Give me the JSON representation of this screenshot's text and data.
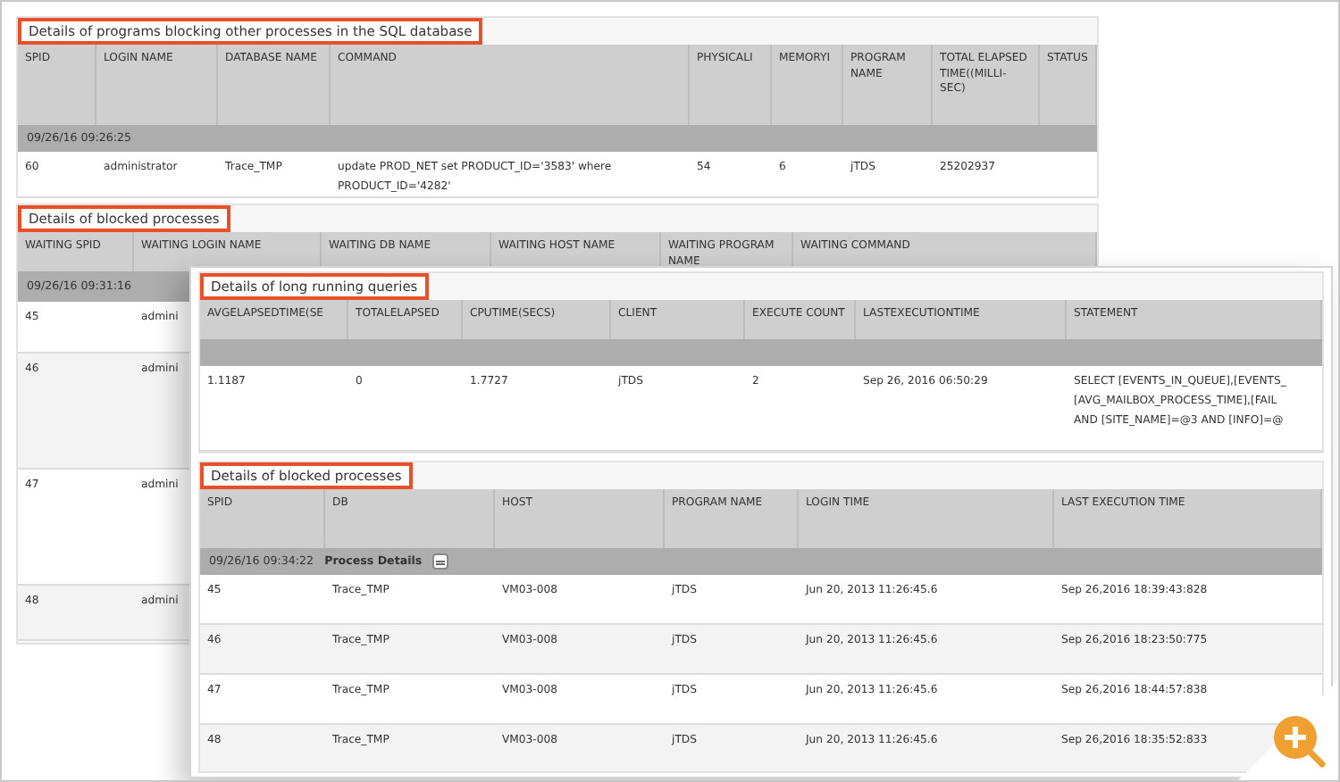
{
  "back_panels": [
    {
      "title": "Details of programs blocking other processes in the SQL database",
      "columns": [
        "SPID",
        "LOGIN NAME",
        "DATABASE NAME",
        "COMMAND",
        "PHYSICALI",
        "MEMORYI",
        "PROGRAM NAME",
        "TOTAL ELAPSED TIME((MILLI-SEC)",
        "STATUS"
      ],
      "groups": [
        {
          "label": "09/26/16 09:26:25",
          "rows": [
            [
              "60",
              "administrator",
              "Trace_TMP",
              "update PROD_NET set PRODUCT_ID='3583' where\nPRODUCT_ID='4282'",
              "54",
              "6",
              "jTDS",
              "25202937"
            ]
          ]
        }
      ]
    },
    {
      "title": "Details of blocked processes",
      "columns": [
        "WAITING SPID",
        "WAITING LOGIN NAME",
        "WAITING DB NAME",
        "WAITING HOST NAME",
        "WAITING PROGRAM NAME",
        "WAITING COMMAND"
      ],
      "groups": [
        {
          "label": "09/26/16 09:31:16",
          "rows": [
            [
              "45",
              "admini"
            ],
            [
              "46",
              "admini"
            ],
            [
              "47",
              "admini"
            ],
            [
              "48",
              "admini"
            ]
          ]
        }
      ]
    }
  ],
  "front_panel": {
    "sections": [
      {
        "title": "Details of long running queries",
        "columns": [
          "AVGELAPSEDTIME(SE",
          "TOTALELAPSED",
          "CPUTIME(SECS)",
          "CLIENT",
          "EXECUTE COUNT",
          "LASTEXECUTIONTIME",
          "STATEMENT"
        ],
        "groups": [
          {
            "rows": [
              [
                "1.1187",
                "0",
                "1.7727",
                "jTDS",
                "2",
                "Sep 26, 2016 06:50:29",
                "SELECT [EVENTS_IN_QUEUE],[EVENTS_\n[AVG_MAILBOX_PROCESS_TIME],[FAIL\nAND [SITE_NAME]=@3 AND [INFO]=@"
              ]
            ]
          }
        ]
      },
      {
        "title": "Details of blocked processes",
        "columns": [
          "SPID",
          "DB",
          "HOST",
          "PROGRAM NAME",
          "LOGIN TIME",
          "LAST EXECUTION TIME"
        ],
        "groups": [
          {
            "label": "09/26/16 09:34:22",
            "detail": "Process Details",
            "collapsed": false,
            "rows": [
              [
                "45",
                "Trace_TMP",
                "VM03-008",
                "jTDS",
                "Jun 20, 2013 11:26:45.6",
                "Sep 26,2016 18:39:43:828"
              ],
              [
                "46",
                "Trace_TMP",
                "VM03-008",
                "jTDS",
                "Jun 20, 2013 11:26:45.6",
                "Sep 26,2016 18:23:50:775"
              ],
              [
                "47",
                "Trace_TMP",
                "VM03-008",
                "jTDS",
                "Jun 20, 2013 11:26:45.6",
                "Sep 26,2016 18:44:57:838"
              ],
              [
                "48",
                "Trace_TMP",
                "VM03-008",
                "jTDS",
                "Jun 20, 2013 11:26:45.6",
                "Sep 26,2016 18:35:52:833"
              ]
            ]
          }
        ]
      }
    ]
  }
}
